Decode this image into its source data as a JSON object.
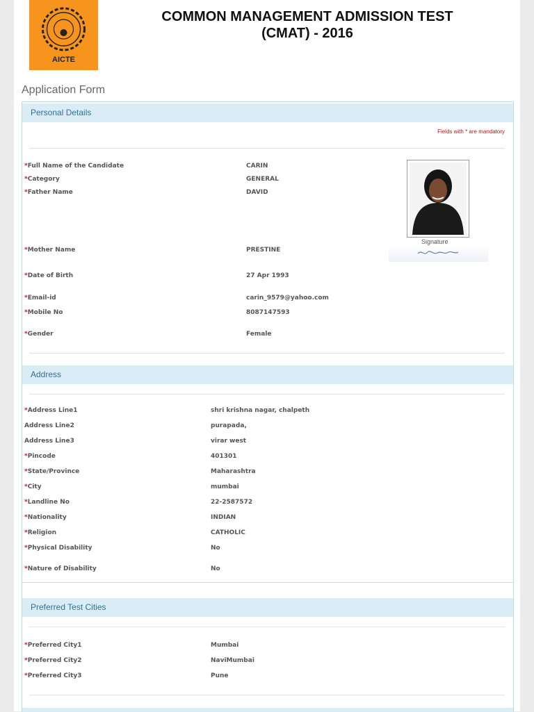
{
  "header": {
    "logo_text": "AICTE",
    "title_line1": "COMMON MANAGEMENT ADMISSION TEST",
    "title_line2": "(CMAT) - 2016"
  },
  "form_title": "Application Form",
  "personal": {
    "heading": "Personal Details",
    "mandatory_note": "Fields with * are mandatory",
    "signature_label": "Signature",
    "fields": [
      {
        "label": "Full Name of the Candidate",
        "value": "CARIN",
        "required": true
      },
      {
        "label": "Category",
        "value": "GENERAL",
        "required": true
      },
      {
        "label": "Father Name",
        "value": "DAVID",
        "required": true
      },
      {
        "label": "Mother Name",
        "value": "PRESTINE",
        "required": true
      },
      {
        "label": "Date of Birth",
        "value": "27 Apr 1993",
        "required": true
      },
      {
        "label": "Email-id",
        "value": "carin_9579@yahoo.com",
        "required": true
      },
      {
        "label": "Mobile No",
        "value": "8087147593",
        "required": true
      },
      {
        "label": "Gender",
        "value": "Female",
        "required": true
      }
    ]
  },
  "address": {
    "heading": "Address",
    "fields": [
      {
        "label": "Address Line1",
        "value": "shri krishna nagar, chalpeth",
        "required": true
      },
      {
        "label": "Address Line2",
        "value": "purapada,",
        "required": false
      },
      {
        "label": "Address Line3",
        "value": "virar west",
        "required": false
      },
      {
        "label": "Pincode",
        "value": "401301",
        "required": true
      },
      {
        "label": "State/Province",
        "value": "Maharashtra",
        "required": true
      },
      {
        "label": "City",
        "value": "mumbai",
        "required": true
      },
      {
        "label": "Landline No",
        "value": "22-2587572",
        "required": true
      },
      {
        "label": "Nationality",
        "value": "INDIAN",
        "required": true
      },
      {
        "label": "Religion",
        "value": "CATHOLIC",
        "required": true
      },
      {
        "label": "Physical Disability",
        "value": "No",
        "required": true
      },
      {
        "label": "Nature of Disability",
        "value": "No",
        "required": true
      }
    ]
  },
  "cities": {
    "heading": "Preferred Test Cities",
    "fields": [
      {
        "label": "Preferred City1",
        "value": "Mumbai",
        "required": true
      },
      {
        "label": "Preferred City2",
        "value": "NaviMumbai",
        "required": true
      },
      {
        "label": "Preferred City3",
        "value": "Pune",
        "required": true
      }
    ]
  },
  "colors": {
    "section_header_bg": "#daedf6",
    "section_header_text": "#31708f",
    "required_star": "#d01010",
    "logo_bg": "#f7941d"
  }
}
